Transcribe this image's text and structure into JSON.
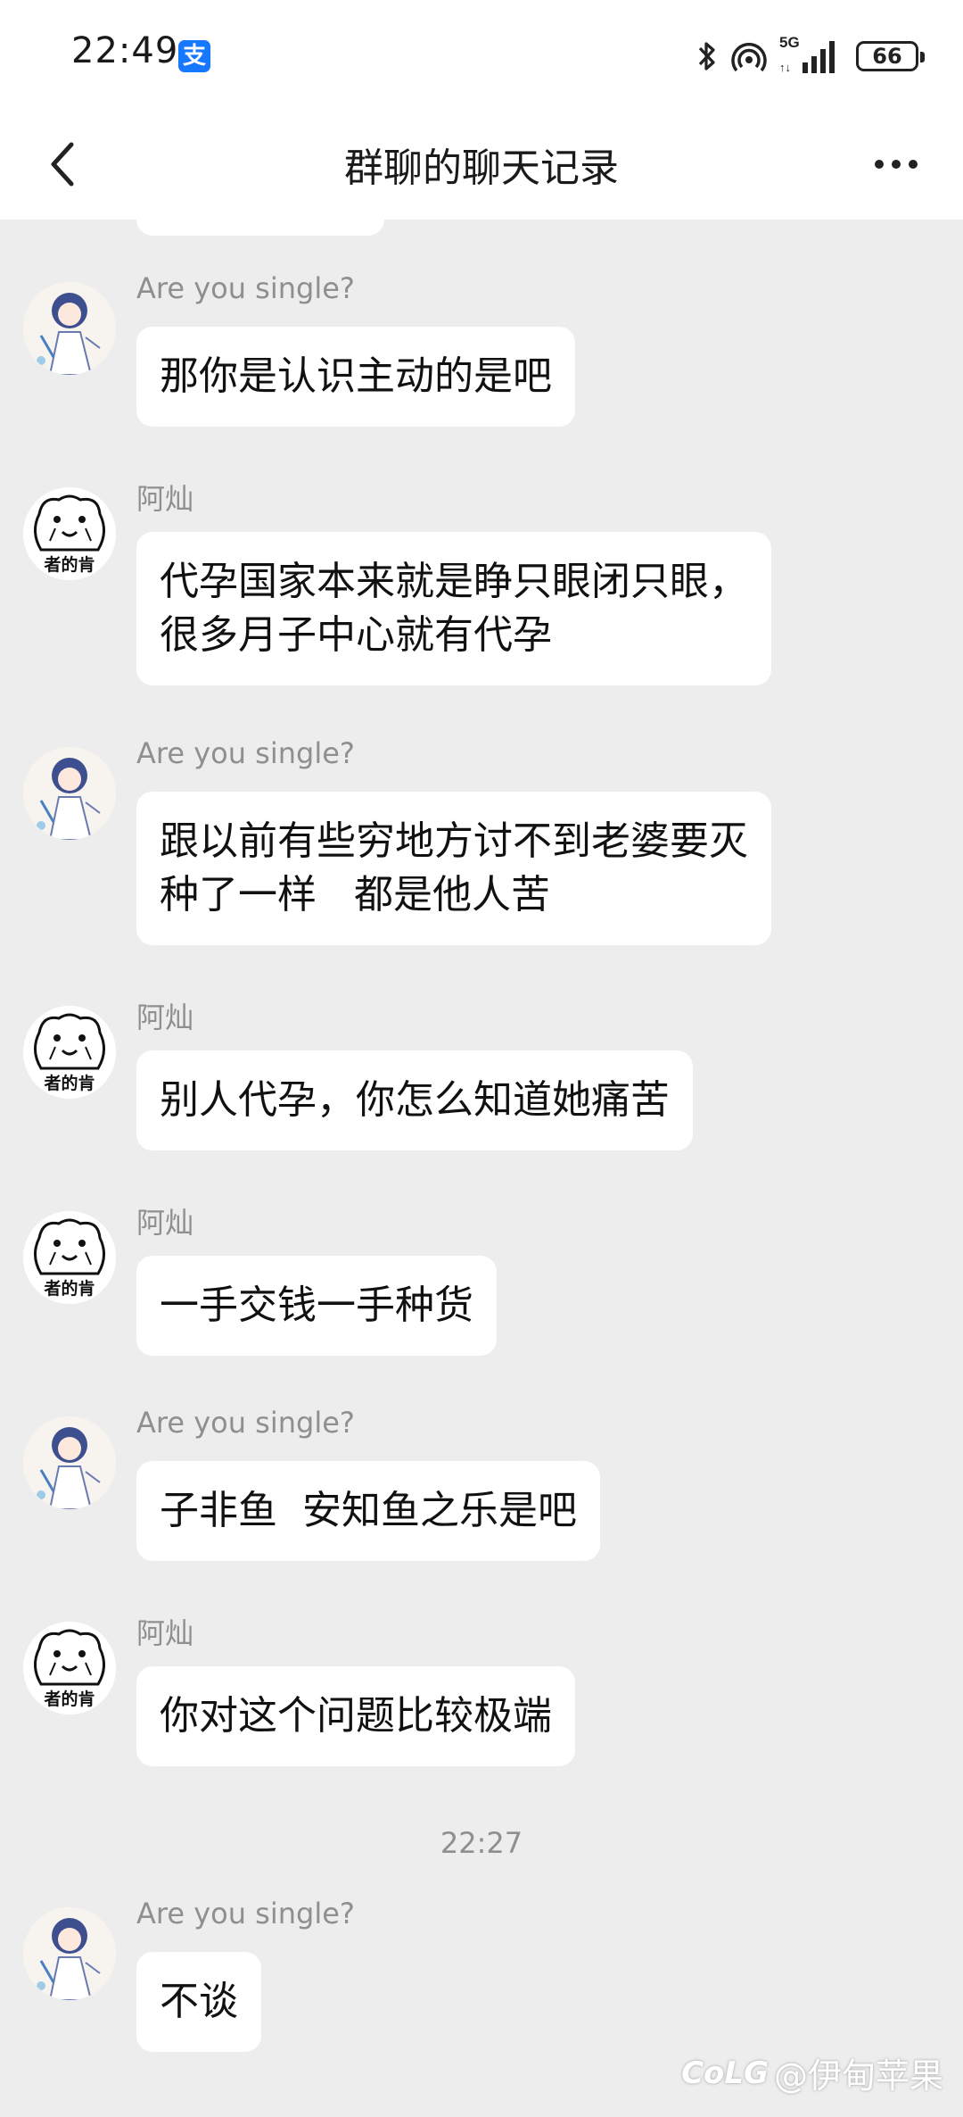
{
  "status_bar": {
    "time": "22:49",
    "alipay_badge": "支",
    "signal_label": "5G",
    "battery": "66"
  },
  "nav": {
    "title": "群聊的聊天记录"
  },
  "messages": [
    {
      "sender": "Are you single?",
      "avatar": "anime-girl-avatar",
      "text": "那你是认识主动的是吧"
    },
    {
      "sender": "阿灿",
      "avatar": "meme-bear-avatar",
      "text": "代孕国家本来就是睁只眼闭只眼，\n很多月子中心就有代孕"
    },
    {
      "sender": "Are you single?",
      "avatar": "anime-girl-avatar",
      "text": "跟以前有些穷地方讨不到老婆要灭\n种了一样   都是他人苦"
    },
    {
      "sender": "阿灿",
      "avatar": "meme-bear-avatar",
      "text": "别人代孕，你怎么知道她痛苦"
    },
    {
      "sender": "阿灿",
      "avatar": "meme-bear-avatar",
      "text": "一手交钱一手种货"
    },
    {
      "sender": "Are you single?",
      "avatar": "anime-girl-avatar",
      "text": "子非鱼  安知鱼之乐是吧"
    },
    {
      "sender": "阿灿",
      "avatar": "meme-bear-avatar",
      "text": "你对这个问题比较极端"
    },
    {
      "sender": "Are you single?",
      "avatar": "anime-girl-avatar",
      "text": "不谈"
    }
  ],
  "time_divider": "22:27",
  "meme_avatar_caption": "者的肯",
  "watermark": {
    "logo": "CoLG",
    "text": "@伊甸苹果"
  },
  "colors": {
    "background": "#ededed",
    "bubble": "#ffffff",
    "sender_text": "#8f8f8f"
  }
}
